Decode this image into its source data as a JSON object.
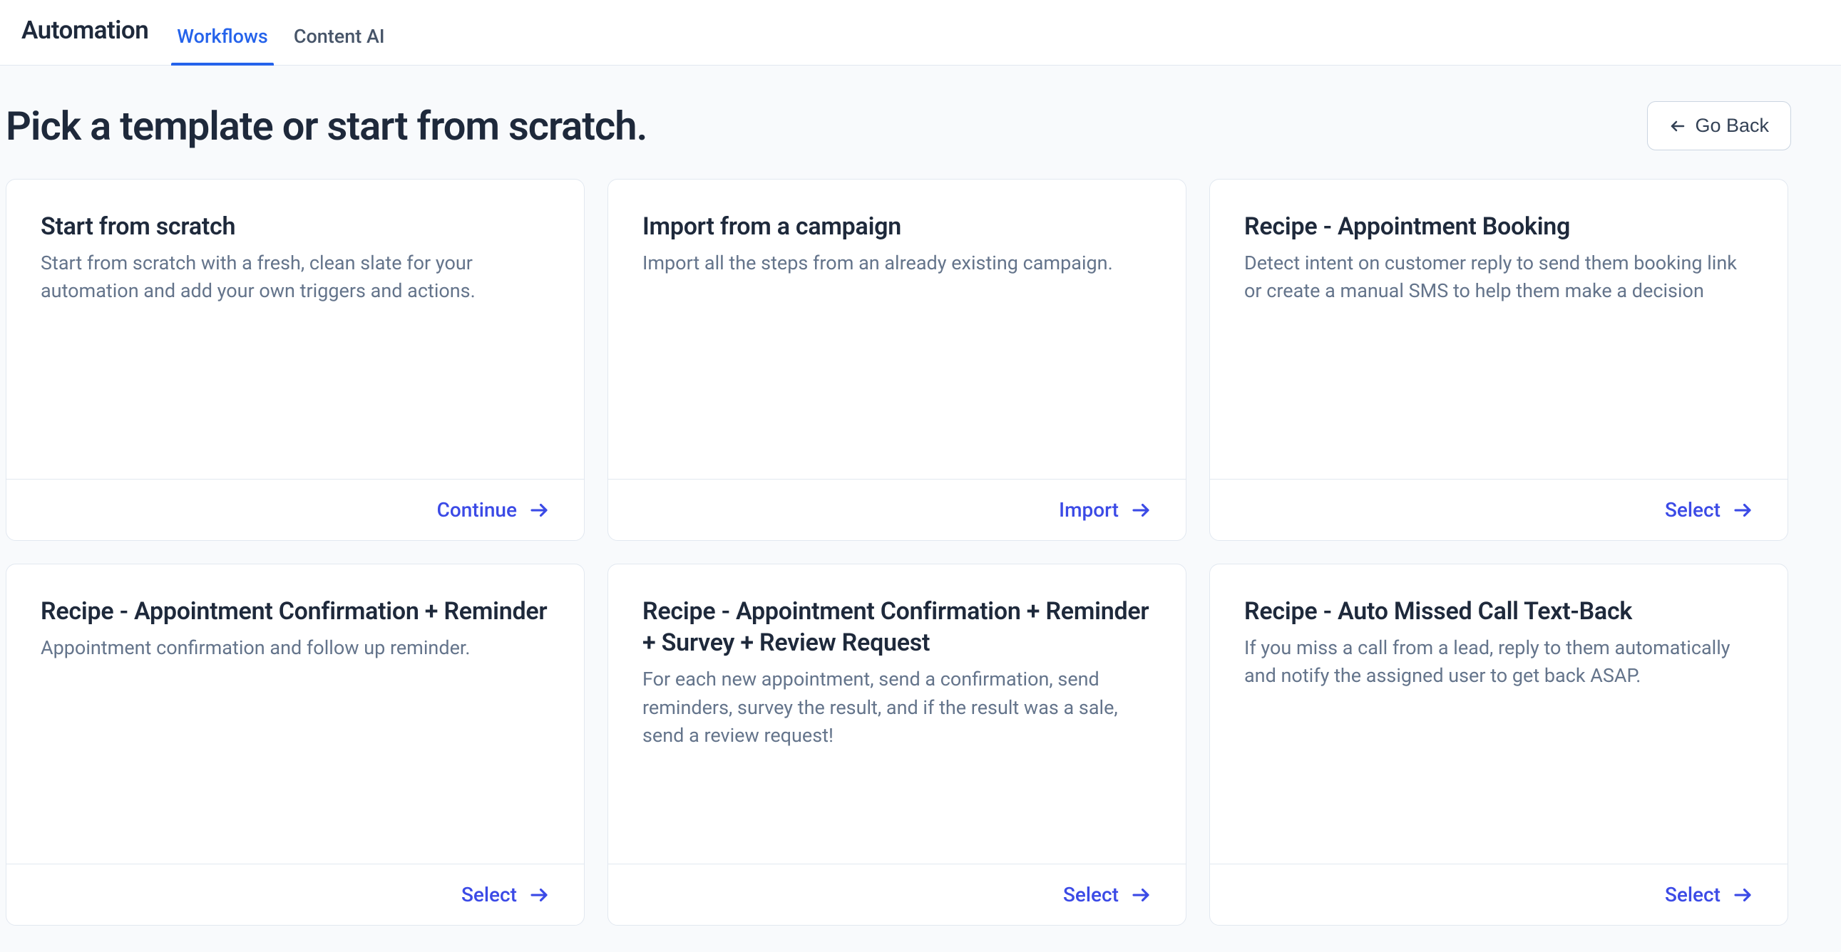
{
  "header": {
    "title": "Automation",
    "tabs": [
      {
        "label": "Workflows",
        "active": true
      },
      {
        "label": "Content AI",
        "active": false
      }
    ]
  },
  "hero": {
    "title": "Pick a template or start from scratch.",
    "go_back_label": "Go Back"
  },
  "cards": [
    {
      "title": "Start from scratch",
      "desc": "Start from scratch with a fresh, clean slate for your automation and add your own triggers and actions.",
      "action": "Continue"
    },
    {
      "title": "Import from a campaign",
      "desc": "Import all the steps from an already existing campaign.",
      "action": "Import"
    },
    {
      "title": "Recipe - Appointment Booking",
      "desc": "Detect intent on customer reply to send them booking link or create a manual SMS to help them make a decision",
      "action": "Select"
    },
    {
      "title": "Recipe - Appointment Confirmation + Reminder",
      "desc": "Appointment confirmation and follow up reminder.",
      "action": "Select"
    },
    {
      "title": "Recipe - Appointment Confirmation + Reminder + Survey + Review Request",
      "desc": "For each new appointment, send a confirmation, send reminders, survey the result, and if the result was a sale, send a review request!",
      "action": "Select"
    },
    {
      "title": "Recipe - Auto Missed Call Text-Back",
      "desc": "If you miss a call from a lead, reply to them automatically and notify the assigned user to get back ASAP.",
      "action": "Select"
    }
  ]
}
